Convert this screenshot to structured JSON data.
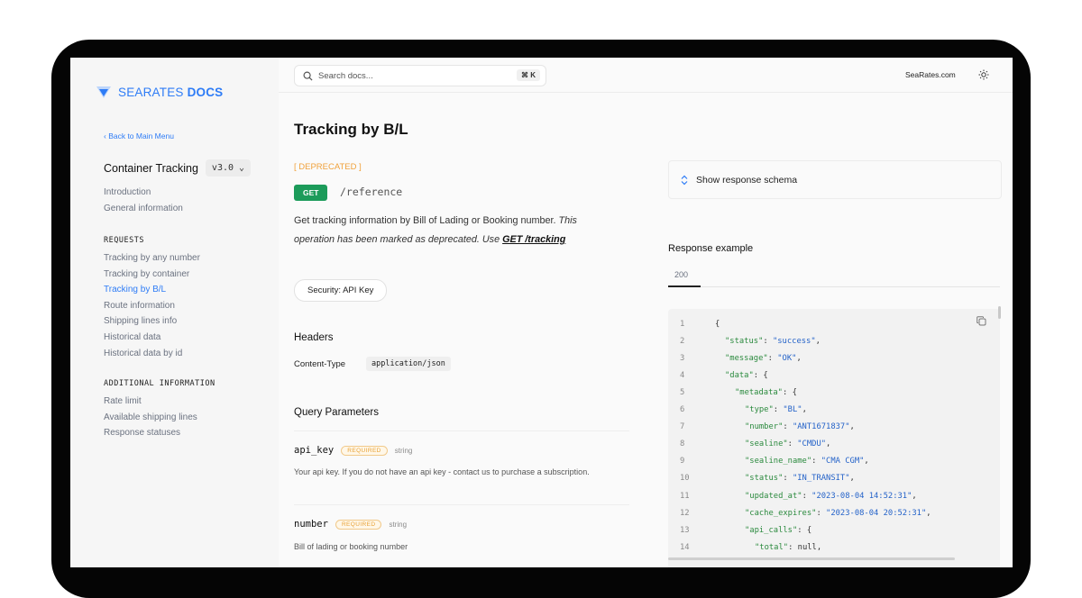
{
  "sidebar": {
    "brand": "SEARATES",
    "brand_bold": "DOCS",
    "back_link": "‹ Back to Main Menu",
    "product": "Container Tracking",
    "version": "v3.0 ⌄",
    "intro_items": [
      "Introduction",
      "General information"
    ],
    "requests_heading": "REQUESTS",
    "requests_items": [
      "Tracking by any number",
      "Tracking by container",
      "Tracking by B/L",
      "Route information",
      "Shipping lines info",
      "Historical data",
      "Historical data by id"
    ],
    "additional_heading": "ADDITIONAL INFORMATION",
    "additional_items": [
      "Rate limit",
      "Available shipping lines",
      "Response statuses"
    ],
    "active_item": "Tracking by B/L"
  },
  "topbar": {
    "search_placeholder": "Search docs...",
    "search_shortcut": "⌘ K",
    "site_link": "SeaRates.com",
    "theme_icon": "sun-icon"
  },
  "main": {
    "title": "Tracking by B/L",
    "deprecated": "[ DEPRECATED ]",
    "method": "GET",
    "path": "/reference",
    "description_plain": "Get tracking information by Bill of Lading or Booking number.",
    "description_italic": " This operation has been marked as deprecated. Use ",
    "description_link": "GET /tracking",
    "security_label": "Security: API Key",
    "headers_title": "Headers",
    "header_name": "Content-Type",
    "header_value": "application/json",
    "query_title": "Query Parameters",
    "params": [
      {
        "name": "api_key",
        "required": "REQUIRED",
        "type": "string",
        "description": "Your api key. If you do not have an api key - contact us to purchase a subscription."
      },
      {
        "name": "number",
        "required": "REQUIRED",
        "type": "string",
        "description": "Bill of lading or booking number"
      }
    ]
  },
  "response": {
    "schema_button": "Show response schema",
    "example_title": "Response example",
    "status_tab": "200",
    "code_lines": [
      {
        "n": "1",
        "indent": 0,
        "key": "",
        "val": "",
        "tail": "{"
      },
      {
        "n": "2",
        "indent": 1,
        "key": "\"status\"",
        "val": "\"success\"",
        "tail": ","
      },
      {
        "n": "3",
        "indent": 1,
        "key": "\"message\"",
        "val": "\"OK\"",
        "tail": ","
      },
      {
        "n": "4",
        "indent": 1,
        "key": "\"data\"",
        "val": "",
        "tail": "{"
      },
      {
        "n": "5",
        "indent": 2,
        "key": "\"metadata\"",
        "val": "",
        "tail": "{"
      },
      {
        "n": "6",
        "indent": 3,
        "key": "\"type\"",
        "val": "\"BL\"",
        "tail": ","
      },
      {
        "n": "7",
        "indent": 3,
        "key": "\"number\"",
        "val": "\"ANT1671837\"",
        "tail": ","
      },
      {
        "n": "8",
        "indent": 3,
        "key": "\"sealine\"",
        "val": "\"CMDU\"",
        "tail": ","
      },
      {
        "n": "9",
        "indent": 3,
        "key": "\"sealine_name\"",
        "val": "\"CMA CGM\"",
        "tail": ","
      },
      {
        "n": "10",
        "indent": 3,
        "key": "\"status\"",
        "val": "\"IN_TRANSIT\"",
        "tail": ","
      },
      {
        "n": "11",
        "indent": 3,
        "key": "\"updated_at\"",
        "val": "\"2023-08-04 14:52:31\"",
        "tail": ","
      },
      {
        "n": "12",
        "indent": 3,
        "key": "\"cache_expires\"",
        "val": "\"2023-08-04 20:52:31\"",
        "tail": ","
      },
      {
        "n": "13",
        "indent": 3,
        "key": "\"api_calls\"",
        "val": "",
        "tail": "{"
      },
      {
        "n": "14",
        "indent": 4,
        "key": "\"total\"",
        "val": "null",
        "tail": ","
      }
    ]
  },
  "colors": {
    "accent": "#2e7cf6",
    "get_badge": "#1c9b5a",
    "deprecated": "#f0a23c",
    "json_key": "#2b8a3e",
    "json_string": "#2563c9"
  }
}
